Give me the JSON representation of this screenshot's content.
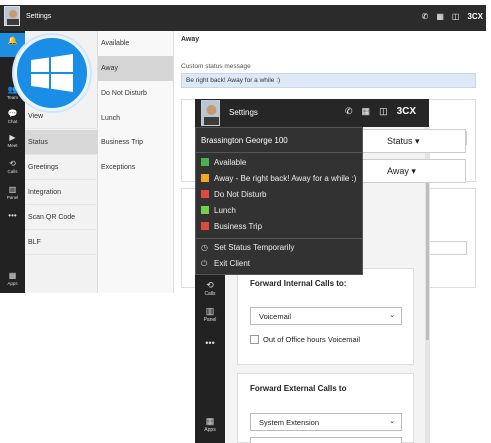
{
  "background_window": {
    "title": "Settings",
    "brand": "3CX",
    "rail": [
      {
        "label": "",
        "icon": "bell-icon"
      },
      {
        "label": "",
        "icon": "windows-icon"
      },
      {
        "label": "Team",
        "icon": "team-icon"
      },
      {
        "label": "Chat",
        "icon": "chat-icon"
      },
      {
        "label": "Meet",
        "icon": "meet-icon"
      },
      {
        "label": "Calls",
        "icon": "calls-icon"
      },
      {
        "label": "Panel",
        "icon": "panel-icon"
      },
      {
        "label": "",
        "icon": "more-icon"
      },
      {
        "label": "Apps",
        "icon": "apps-icon"
      }
    ],
    "status_column": [
      "View",
      "Status",
      "Greetings",
      "Integration",
      "Scan QR Code",
      "BLF"
    ],
    "options_column": [
      "Available",
      "Away",
      "Do Not Disturb",
      "Lunch",
      "Business Trip",
      "Exceptions"
    ],
    "detail": {
      "heading": "Away",
      "custom_status_label": "Custom status message",
      "custom_status_value": "Be right back! Away for a while :)"
    }
  },
  "foreground_window": {
    "title": "Settings",
    "rail": [
      {
        "label": "Calls",
        "icon": "calls-icon"
      },
      {
        "label": "Panel",
        "icon": "panel-icon"
      },
      {
        "label": "",
        "icon": "more-icon"
      },
      {
        "label": "Apps",
        "icon": "apps-icon"
      }
    ],
    "status_label": "Status",
    "away_label": "Away",
    "forward_internal": {
      "title": "Forward Internal Calls to:",
      "select_value": "Voicemail",
      "checkbox_label": "Out of Office hours Voicemail"
    },
    "forward_external": {
      "title": "Forward External Calls to",
      "select_value": "System Extension"
    }
  },
  "status_menu": {
    "user": "Brassington George 100",
    "statuses": [
      {
        "label": "Available",
        "color": "#4caf50"
      },
      {
        "label": "Away - Be right back! Away for a while :)",
        "color": "#f5a623"
      },
      {
        "label": "Do Not Disturb",
        "color": "#e0493c"
      },
      {
        "label": "Lunch",
        "color": "#76d04b"
      },
      {
        "label": "Business Trip",
        "color": "#e0493c"
      }
    ],
    "actions": [
      {
        "label": "Set Status Temporarily",
        "icon": "clock-icon"
      },
      {
        "label": "Exit Client",
        "icon": "power-icon"
      }
    ]
  },
  "colors": {
    "accent": "#1e8fe0",
    "titlebar": "#2b2b2b"
  }
}
